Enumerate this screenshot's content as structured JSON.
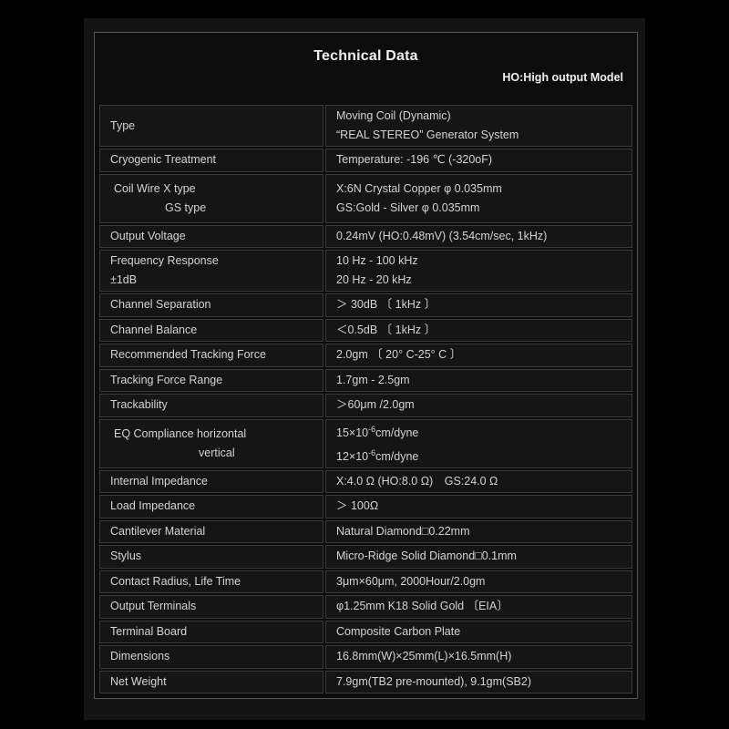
{
  "title": "Technical Data",
  "subtitle": "HO:High output Model",
  "rows": [
    {
      "key": [
        "Type"
      ],
      "value": [
        "Moving Coil (Dynamic)",
        "“REAL STEREO” Generator System"
      ]
    },
    {
      "key": [
        "Cryogenic Treatment"
      ],
      "value": [
        "Temperature: -196 ℃ (-320oF)"
      ]
    },
    {
      "key": [
        "Coil Wire X type",
        "GS type"
      ],
      "value": [
        "X:6N Crystal Copper φ 0.035mm",
        "GS:Gold - Silver φ 0.035mm"
      ]
    },
    {
      "key": [
        "Output Voltage"
      ],
      "value": [
        "0.24mV (HO:0.48mV) (3.54cm/sec, 1kHz)"
      ]
    },
    {
      "key": [
        "Frequency Response",
        "±1dB"
      ],
      "value": [
        "10 Hz - 100 kHz",
        "20 Hz - 20 kHz"
      ]
    },
    {
      "key": [
        "Channel Separation"
      ],
      "value": [
        "＞ 30dB 〔 1kHz 〕"
      ]
    },
    {
      "key": [
        "Channel Balance"
      ],
      "value": [
        "＜0.5dB 〔 1kHz 〕"
      ]
    },
    {
      "key": [
        "Recommended Tracking Force"
      ],
      "value": [
        "2.0gm 〔 20° C-25° C 〕"
      ]
    },
    {
      "key": [
        "Tracking Force Range"
      ],
      "value": [
        "1.7gm - 2.5gm"
      ]
    },
    {
      "key": [
        "Trackability"
      ],
      "value": [
        "＞60μm /2.0gm"
      ]
    },
    {
      "key": [
        "EQ Compliance horizontal",
        "vertical"
      ],
      "value_base": "15×10",
      "value_exp": "-6",
      "value_unit": "cm/dyne",
      "value_base2": "12×10",
      "value_exp2": "-6",
      "value_unit2": "cm/dyne"
    },
    {
      "key": [
        "Internal Impedance"
      ],
      "value": [
        "X:4.0 Ω (HO:8.0 Ω)　GS:24.0 Ω"
      ]
    },
    {
      "key": [
        "Load Impedance"
      ],
      "value": [
        "＞ 100Ω"
      ]
    },
    {
      "key": [
        "Cantilever Material"
      ],
      "value": [
        "Natural Diamond□0.22mm"
      ]
    },
    {
      "key": [
        "Stylus"
      ],
      "value": [
        "Micro-Ridge Solid Diamond□0.1mm"
      ]
    },
    {
      "key": [
        "Contact Radius, Life Time"
      ],
      "value": [
        "3μm×60μm, 2000Hour/2.0gm"
      ]
    },
    {
      "key": [
        "Output Terminals"
      ],
      "value": [
        "φ1.25mm K18 Solid Gold 〔EIA〕"
      ]
    },
    {
      "key": [
        "Terminal Board"
      ],
      "value": [
        "Composite Carbon Plate"
      ]
    },
    {
      "key": [
        "Dimensions"
      ],
      "value": [
        "16.8mm(W)×25mm(L)×16.5mm(H)"
      ]
    },
    {
      "key": [
        "Net Weight"
      ],
      "value": [
        "7.9gm(TB2 pre-mounted), 9.1gm(SB2)"
      ]
    }
  ]
}
